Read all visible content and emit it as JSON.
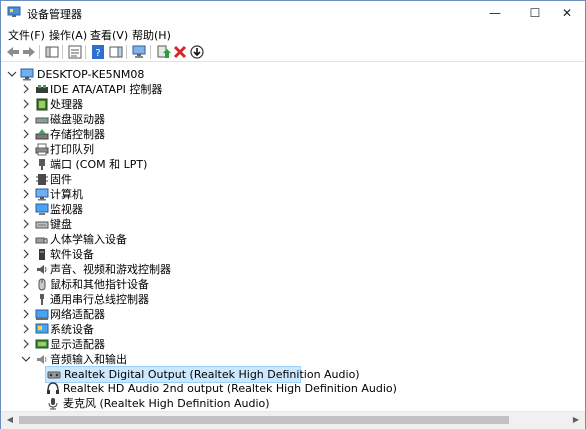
{
  "window": {
    "title": "设备管理器",
    "minimize_glyph": "—",
    "maximize_glyph": "☐",
    "close_glyph": "✕"
  },
  "menu": [
    {
      "label": "文件(F)"
    },
    {
      "label": "操作(A)"
    },
    {
      "label": "查看(V)"
    },
    {
      "label": "帮助(H)"
    }
  ],
  "toolbar": {
    "buttons": [
      {
        "name": "back-arrow-icon"
      },
      {
        "name": "forward-arrow-icon"
      },
      {
        "name": "show-hide-console-tree-icon"
      },
      {
        "name": "properties-icon"
      },
      {
        "name": "help-icon"
      },
      {
        "name": "action-pane-icon"
      },
      {
        "name": "scan-hardware-icon"
      },
      {
        "name": "update-driver-icon"
      },
      {
        "name": "uninstall-device-icon"
      },
      {
        "name": "disable-device-icon"
      }
    ]
  },
  "tree": {
    "root": {
      "label": "DESKTOP-KE5NM08",
      "expanded": true,
      "icon": "computer-icon"
    },
    "categories": [
      {
        "label": "IDE ATA/ATAPI 控制器",
        "icon": "ide-controller-icon"
      },
      {
        "label": "处理器",
        "icon": "processor-icon"
      },
      {
        "label": "磁盘驱动器",
        "icon": "disk-drive-icon"
      },
      {
        "label": "存储控制器",
        "icon": "storage-controller-icon"
      },
      {
        "label": "打印队列",
        "icon": "printer-icon"
      },
      {
        "label": "端口 (COM 和 LPT)",
        "icon": "port-icon"
      },
      {
        "label": "固件",
        "icon": "firmware-icon"
      },
      {
        "label": "计算机",
        "icon": "computer-icon"
      },
      {
        "label": "监视器",
        "icon": "monitor-icon"
      },
      {
        "label": "键盘",
        "icon": "keyboard-icon"
      },
      {
        "label": "人体学输入设备",
        "icon": "hid-icon"
      },
      {
        "label": "软件设备",
        "icon": "software-device-icon"
      },
      {
        "label": "声音、视频和游戏控制器",
        "icon": "sound-icon"
      },
      {
        "label": "鼠标和其他指针设备",
        "icon": "mouse-icon"
      },
      {
        "label": "通用串行总线控制器",
        "icon": "usb-icon"
      },
      {
        "label": "网络适配器",
        "icon": "network-adapter-icon"
      },
      {
        "label": "系统设备",
        "icon": "system-device-icon"
      },
      {
        "label": "显示适配器",
        "icon": "display-adapter-icon"
      },
      {
        "label": "音频输入和输出",
        "icon": "audio-io-icon",
        "expanded": true
      }
    ],
    "children": [
      {
        "label": "Realtek Digital Output (Realtek High Definition Audio)",
        "icon": "speaker-device-icon",
        "selected": true
      },
      {
        "label": "Realtek HD Audio 2nd output (Realtek High Definition Audio)",
        "icon": "headphones-icon",
        "selected": false
      },
      {
        "label": "麦克风 (Realtek High Definition Audio)",
        "icon": "microphone-icon",
        "selected": false
      }
    ]
  },
  "scrollbar": {
    "left_glyph": "◀",
    "right_glyph": "▶"
  }
}
